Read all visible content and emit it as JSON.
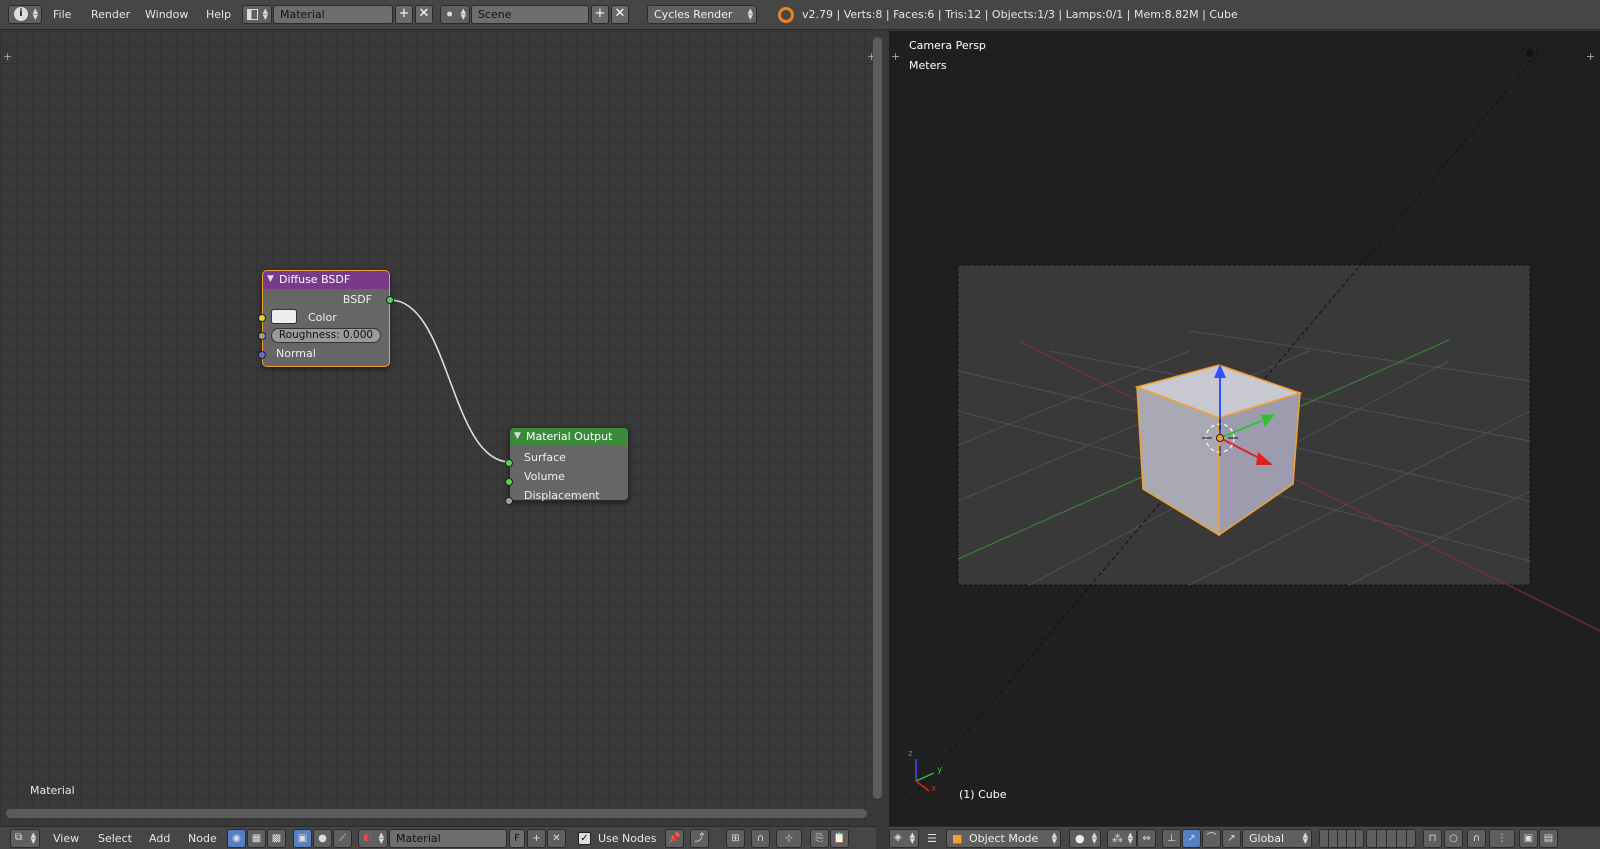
{
  "topbar": {
    "menus": [
      "File",
      "Render",
      "Window",
      "Help"
    ],
    "layout_field": "Material",
    "scene_field": "Scene",
    "engine": "Cycles Render",
    "stats": "v2.79 | Verts:8 | Faces:6 | Tris:12 | Objects:1/3 | Lamps:0/1 | Mem:8.82M | Cube"
  },
  "node_editor": {
    "label": "Material",
    "nodes": {
      "diffuse": {
        "title": "Diffuse BSDF",
        "output": "BSDF",
        "color_label": "Color",
        "roughness": "Roughness: 0.000",
        "normal": "Normal",
        "header_color": "#7a3a8a"
      },
      "output": {
        "title": "Material Output",
        "surface": "Surface",
        "volume": "Volume",
        "displacement": "Displacement",
        "header_color": "#3a8a3a"
      }
    },
    "footer": {
      "menus": [
        "View",
        "Select",
        "Add",
        "Node"
      ],
      "material_field": "Material",
      "fake_user": "F",
      "use_nodes_label": "Use Nodes",
      "use_nodes_checked": true
    }
  },
  "viewport": {
    "title": "Camera Persp",
    "units": "Meters",
    "object_label": "(1) Cube",
    "axis_labels": {
      "x": "x",
      "y": "y",
      "z": "z"
    },
    "footer": {
      "mode": "Object Mode",
      "orientation": "Global"
    },
    "selection_color": "#f0a030"
  }
}
